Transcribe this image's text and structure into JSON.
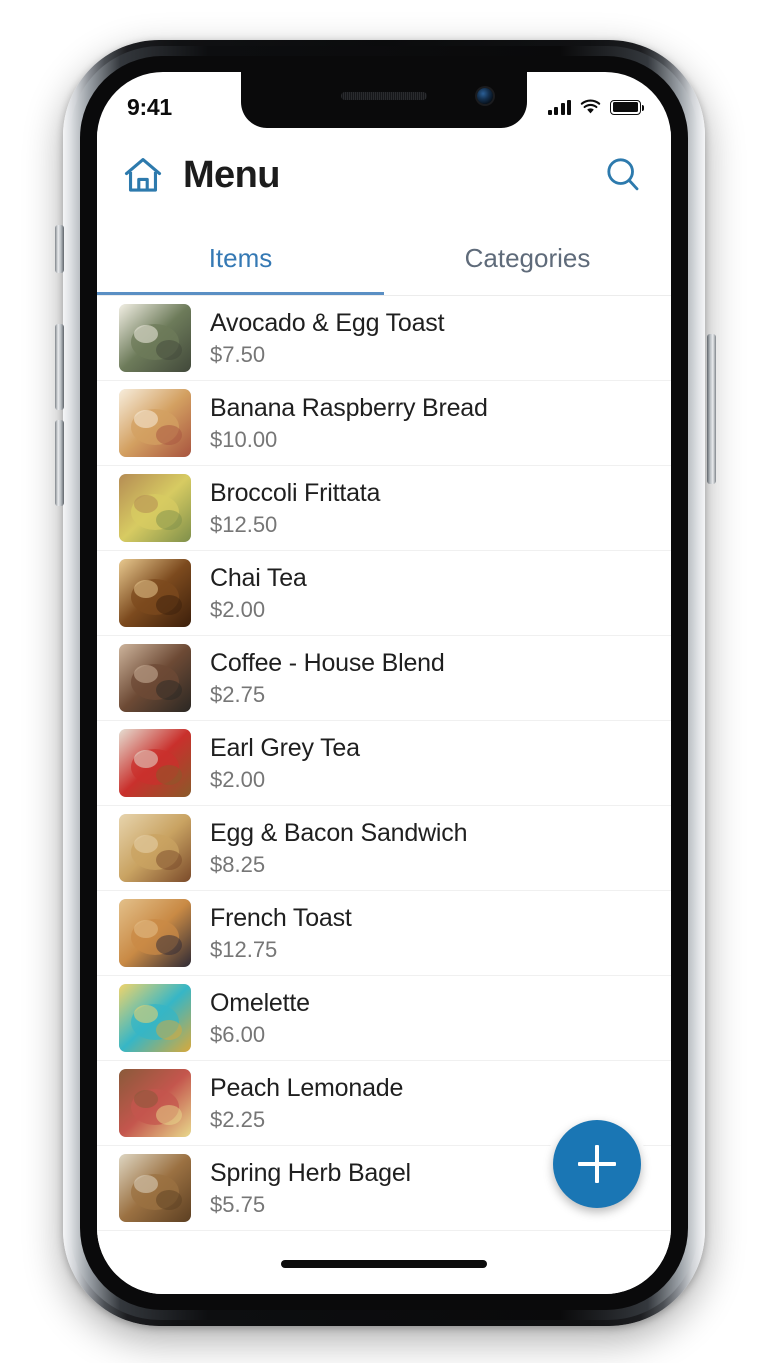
{
  "status_bar": {
    "time": "9:41",
    "signal_icon": "cellular-signal-icon",
    "wifi_icon": "wifi-icon",
    "battery_icon": "battery-full-icon"
  },
  "app_bar": {
    "home_icon": "home-icon",
    "title": "Menu",
    "search_icon": "search-icon"
  },
  "tabs": [
    {
      "label": "Items",
      "active": true
    },
    {
      "label": "Categories",
      "active": false
    }
  ],
  "colors": {
    "accent": "#1a76b4",
    "tab_active_text": "#3579b4",
    "tab_inactive_text": "#5f6b7a",
    "tab_underline": "#5a8fc4",
    "icon_blue": "#2d7aad",
    "item_name": "#1f1f1f",
    "item_price": "#767676",
    "divider": "#f0f0f0",
    "screen_bg": "#ffffff"
  },
  "menu_items": [
    {
      "name": "Avocado & Egg Toast",
      "price": "$7.50",
      "thumb": "avocado-egg-toast-photo",
      "c1": "#6d7b5a",
      "c2": "#41483a",
      "c3": "#f2efe4"
    },
    {
      "name": "Banana Raspberry Bread",
      "price": "$10.00",
      "thumb": "banana-raspberry-bread-photo",
      "c1": "#d3a061",
      "c2": "#a8543f",
      "c3": "#f7eddc"
    },
    {
      "name": "Broccoli Frittata",
      "price": "$12.50",
      "thumb": "broccoli-frittata-photo",
      "c1": "#d7cb62",
      "c2": "#7e8f4a",
      "c3": "#b58c54"
    },
    {
      "name": "Chai Tea",
      "price": "$2.00",
      "thumb": "chai-tea-photo",
      "c1": "#7c4a1e",
      "c2": "#3c1f0b",
      "c3": "#e8c98f"
    },
    {
      "name": "Coffee - House Blend",
      "price": "$2.75",
      "thumb": "coffee-house-blend-photo",
      "c1": "#6d4a35",
      "c2": "#2a2723",
      "c3": "#cdb49c"
    },
    {
      "name": "Earl Grey Tea",
      "price": "$2.00",
      "thumb": "earl-grey-tea-photo",
      "c1": "#c9302c",
      "c2": "#8a5a2a",
      "c3": "#e6ded2"
    },
    {
      "name": "Egg & Bacon Sandwich",
      "price": "$8.25",
      "thumb": "egg-bacon-sandwich-photo",
      "c1": "#c9a362",
      "c2": "#7a4a2a",
      "c3": "#e7d4ad"
    },
    {
      "name": "French Toast",
      "price": "$12.75",
      "thumb": "french-toast-photo",
      "c1": "#c98a45",
      "c2": "#2f2a35",
      "c3": "#e3c08a"
    },
    {
      "name": "Omelette",
      "price": "$6.00",
      "thumb": "omelette-photo",
      "c1": "#36b6c6",
      "c2": "#d9a93a",
      "c3": "#f0d46b"
    },
    {
      "name": "Peach Lemonade",
      "price": "$2.25",
      "thumb": "peach-lemonade-photo",
      "c1": "#c4564d",
      "c2": "#e8d98c",
      "c3": "#8a5a3a"
    },
    {
      "name": "Spring Herb Bagel",
      "price": "$5.75",
      "thumb": "spring-herb-bagel-photo",
      "c1": "#9b7142",
      "c2": "#5c3f22",
      "c3": "#ded6c2"
    }
  ],
  "fab": {
    "label": "+",
    "icon": "plus-icon"
  },
  "home_indicator": "home-indicator"
}
